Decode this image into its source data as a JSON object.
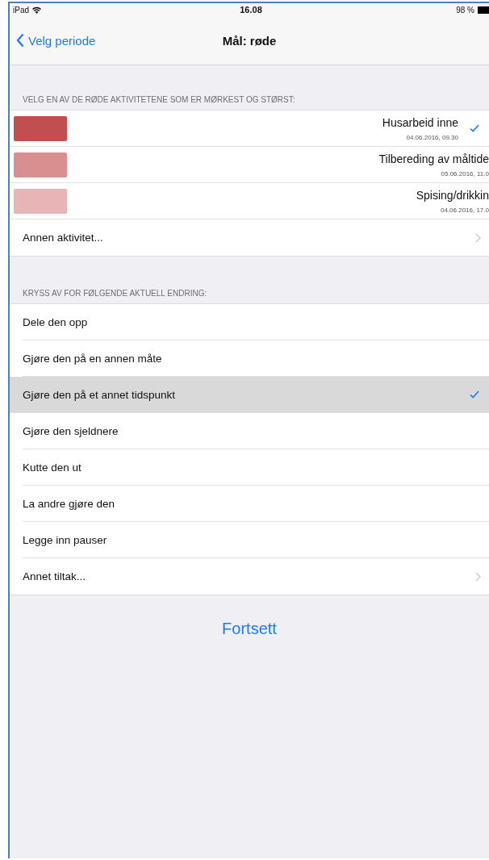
{
  "status_bar": {
    "device": "iPad",
    "time": "16.08",
    "battery": "98 %"
  },
  "nav": {
    "back": "Velg periode",
    "title": "Mål: røde"
  },
  "activities": {
    "header": "VELG EN AV DE RØDE AKTIVITETENE SOM ER MØRKEST OG STØRST:",
    "items": [
      {
        "kind": "swatch",
        "color": "#c24f4f",
        "name": "Husarbeid inne",
        "date": "04.06.2016, 09.30",
        "selected": true
      },
      {
        "kind": "swatch",
        "color": "#d98f90",
        "name": "Tilbereding av måltide",
        "date": "05.06.2016, 11.0",
        "selected": false
      },
      {
        "kind": "swatch",
        "color": "#e8b5b7",
        "name": "Spising/drikkin",
        "date": "04.06.2016, 17.0",
        "selected": false
      },
      {
        "kind": "disclosure",
        "name": "Annen aktivitet..."
      }
    ]
  },
  "changes": {
    "header": "KRYSS AV FOR FØLGENDE AKTUELL ENDRING:",
    "items": [
      {
        "kind": "option",
        "label": "Dele den opp",
        "selected": false
      },
      {
        "kind": "option",
        "label": "Gjøre den på en annen måte",
        "selected": false
      },
      {
        "kind": "option",
        "label": "Gjøre den på et annet tidspunkt",
        "selected": true
      },
      {
        "kind": "option",
        "label": "Gjøre den sjeldnere",
        "selected": false
      },
      {
        "kind": "option",
        "label": "Kutte den ut",
        "selected": false
      },
      {
        "kind": "option",
        "label": "La andre gjøre den",
        "selected": false
      },
      {
        "kind": "option",
        "label": "Legge inn pauser",
        "selected": false
      },
      {
        "kind": "disclosure",
        "label": "Annet tiltak..."
      }
    ]
  },
  "continue_button": "Fortsett"
}
